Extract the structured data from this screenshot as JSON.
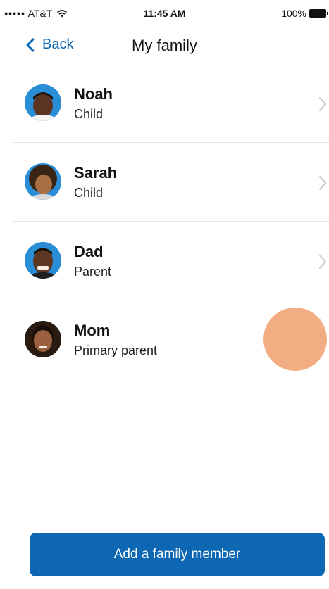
{
  "status_bar": {
    "signal": "●●●●●",
    "carrier": "AT&T",
    "time": "11:45 AM",
    "battery_percent": "100%"
  },
  "nav": {
    "back_label": "Back",
    "title": "My family"
  },
  "members": [
    {
      "name": "Noah",
      "role": "Child"
    },
    {
      "name": "Sarah",
      "role": "Child"
    },
    {
      "name": "Dad",
      "role": "Parent"
    },
    {
      "name": "Mom",
      "role": "Primary parent"
    }
  ],
  "add_button": {
    "label": "Add a family member"
  },
  "colors": {
    "accent": "#0b66b2",
    "button": "#0d67b3",
    "touch_indicator": "#f2a476",
    "avatar_bg": "#2a8ed6"
  }
}
